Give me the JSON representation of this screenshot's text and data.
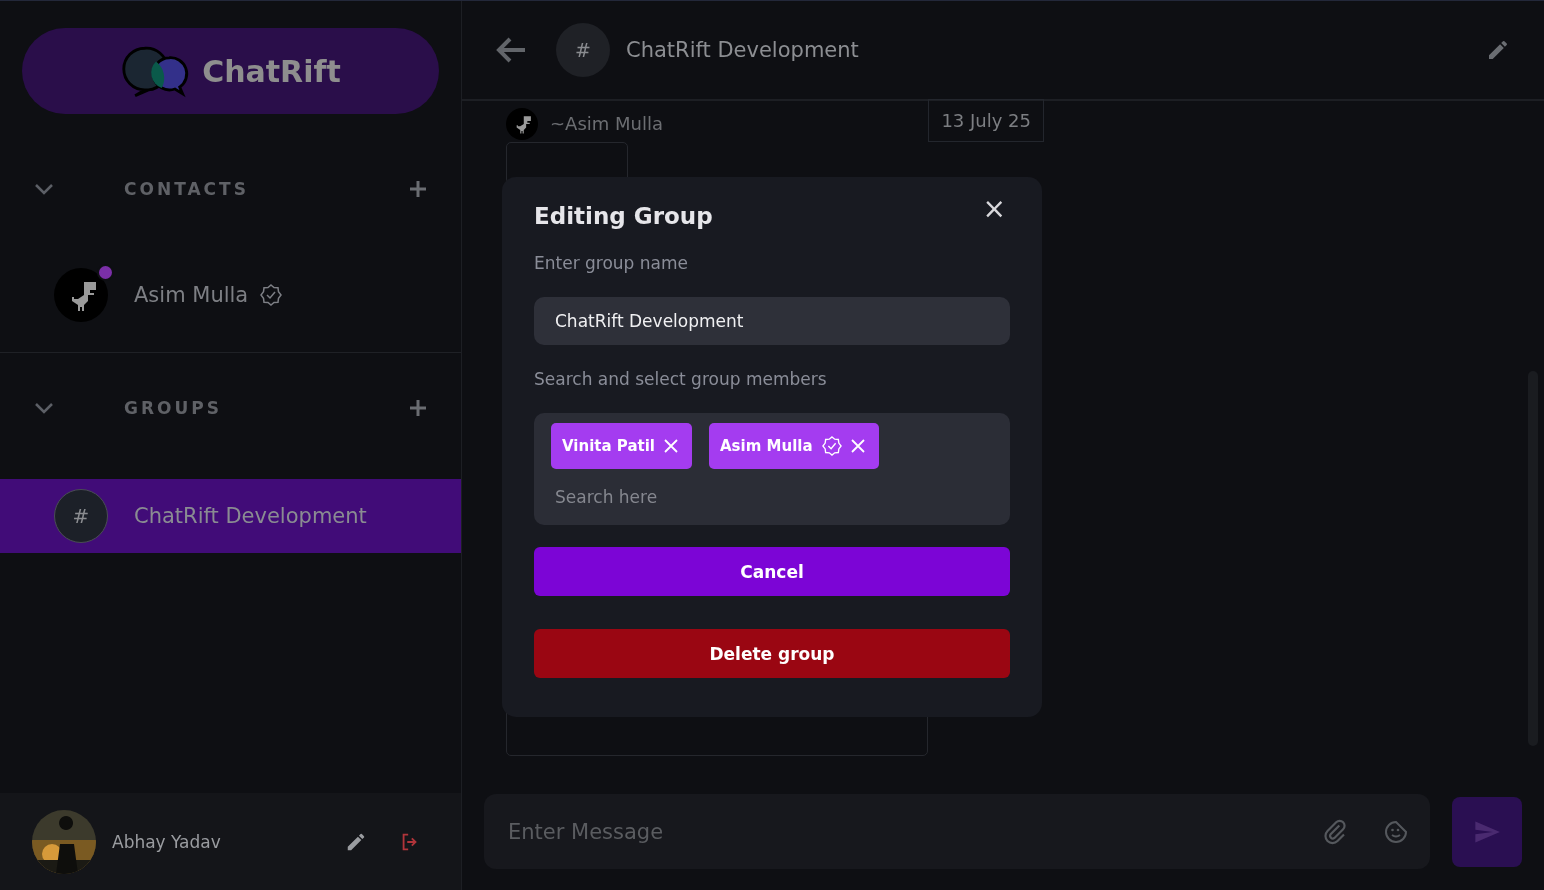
{
  "brand": {
    "name": "ChatRift"
  },
  "sections": [
    {
      "title": "CONTACTS",
      "expanded": true,
      "items": [
        {
          "kind": "contact",
          "name": "Asim Mulla",
          "verified": true,
          "online": true,
          "selected": false
        }
      ]
    },
    {
      "title": "GROUPS",
      "expanded": true,
      "items": [
        {
          "kind": "group",
          "name": "ChatRift Development",
          "avatar": "#",
          "selected": true
        }
      ]
    }
  ],
  "current_user": {
    "name": "Abhay Yadav"
  },
  "chat_header": {
    "avatar": "#",
    "title": "ChatRift Development"
  },
  "messages": [
    {
      "sender": "~Asim Mulla",
      "date": "13 July 25"
    }
  ],
  "composer": {
    "placeholder": "Enter Message"
  },
  "modal": {
    "title": "Editing Group",
    "close": "×",
    "name_label": "Enter group name",
    "name_value": "ChatRift Development",
    "members_label": "Search and select group members",
    "members": [
      {
        "name": "Vinita Patil",
        "verified": false
      },
      {
        "name": "Asim Mulla",
        "verified": true
      }
    ],
    "search_placeholder": "Search here",
    "cancel": "Cancel",
    "delete": "Delete group"
  }
}
